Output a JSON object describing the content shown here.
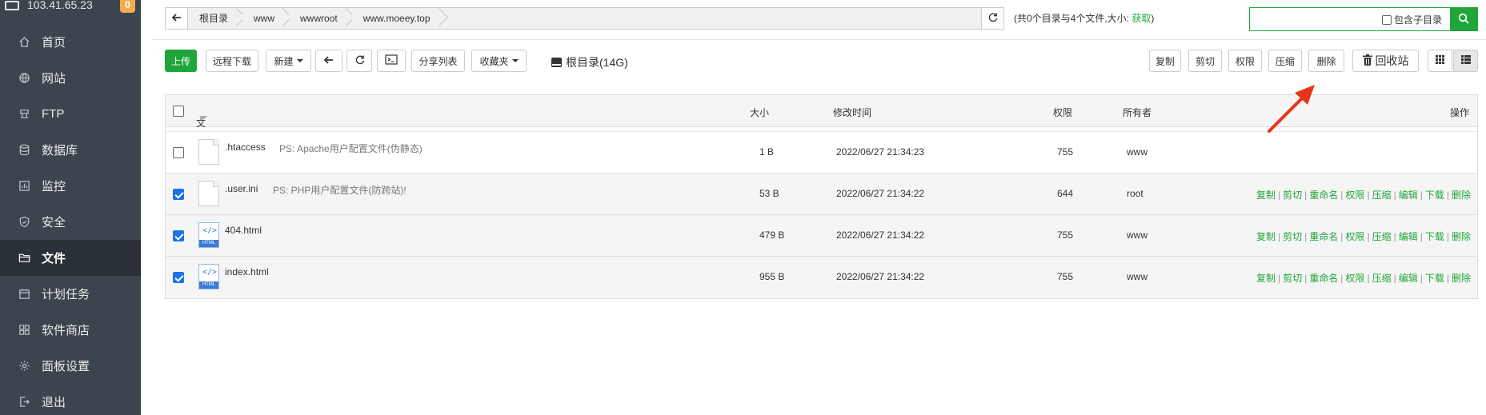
{
  "sidebar": {
    "ip": "103.41.65.23",
    "badge": "0",
    "items": [
      {
        "label": "首页",
        "icon": "home-icon"
      },
      {
        "label": "网站",
        "icon": "globe-icon"
      },
      {
        "label": "FTP",
        "icon": "ftp-icon"
      },
      {
        "label": "数据库",
        "icon": "database-icon"
      },
      {
        "label": "监控",
        "icon": "monitor-icon"
      },
      {
        "label": "安全",
        "icon": "shield-icon"
      },
      {
        "label": "文件",
        "icon": "folder-icon"
      },
      {
        "label": "计划任务",
        "icon": "calendar-icon"
      },
      {
        "label": "软件商店",
        "icon": "apps-icon"
      },
      {
        "label": "面板设置",
        "icon": "gear-icon"
      },
      {
        "label": "退出",
        "icon": "logout-icon"
      }
    ]
  },
  "breadcrumb": [
    "根目录",
    "www",
    "wwwroot",
    "www.moeey.top"
  ],
  "summary": {
    "text": "(共0个目录与4个文件,大小: ",
    "link": "获取",
    "close": ")"
  },
  "search": {
    "placeholder": "",
    "include_sub": "包含子目录"
  },
  "toolbar": {
    "upload": "上传",
    "remote_download": "远程下载",
    "new": "新建",
    "share_list": "分享列表",
    "favorites": "收藏夹",
    "root_disk": "根目录(14G)",
    "copy": "复制",
    "cut": "剪切",
    "permission": "权限",
    "compress": "压缩",
    "delete": "删除",
    "recycle": "回收站"
  },
  "table": {
    "headers": {
      "name": "文件名",
      "size": "大小",
      "mtime": "修改时间",
      "perm": "权限",
      "owner": "所有者",
      "ops": "操作"
    },
    "rows": [
      {
        "name": ".htaccess",
        "ps": "PS: Apache用户配置文件(伪静态)",
        "size": "1 B",
        "mtime": "2022/06/27 21:34:23",
        "perm": "755",
        "owner": "www",
        "checked": false,
        "type": "file",
        "ops": false
      },
      {
        "name": ".user.ini",
        "ps": "PS: PHP用户配置文件(防跨站)!",
        "size": "53 B",
        "mtime": "2022/06/27 21:34:22",
        "perm": "644",
        "owner": "root",
        "checked": true,
        "type": "file",
        "ops": true
      },
      {
        "name": "404.html",
        "ps": "",
        "size": "479 B",
        "mtime": "2022/06/27 21:34:22",
        "perm": "755",
        "owner": "www",
        "checked": true,
        "type": "html",
        "ops": true
      },
      {
        "name": "index.html",
        "ps": "",
        "size": "955 B",
        "mtime": "2022/06/27 21:34:22",
        "perm": "755",
        "owner": "www",
        "checked": true,
        "type": "html",
        "ops": true
      }
    ],
    "row_ops": [
      "复制",
      "剪切",
      "重命名",
      "权限",
      "压缩",
      "编辑",
      "下载",
      "删除"
    ],
    "html_icon_label": "HTML"
  },
  "colors": {
    "accent": "#20a53a",
    "sidebar": "#3c444d",
    "arrow": "#e8341c"
  }
}
